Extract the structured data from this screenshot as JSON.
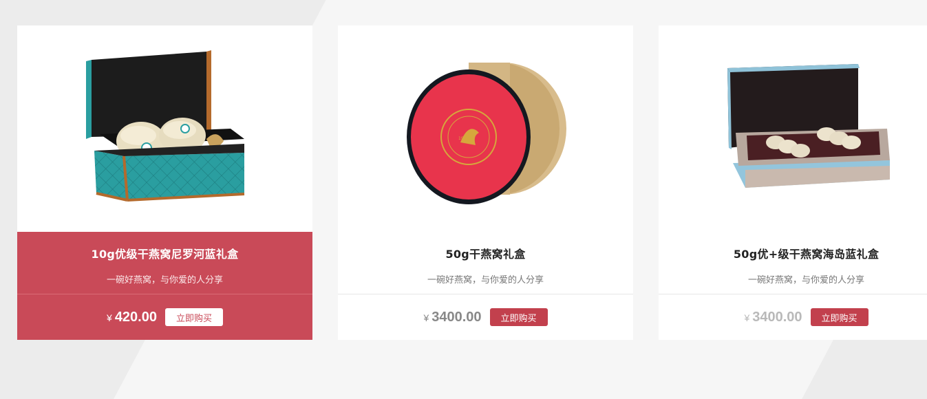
{
  "colors": {
    "accent": "#c94a58",
    "button": "#c2404d",
    "background": "#ececec"
  },
  "products": [
    {
      "name": "10g优级干燕窝尼罗河蓝礼盒",
      "slogan": "一碗好燕窝，与你爱的人分享",
      "currency": "¥",
      "price": "420.00",
      "buy_label": "立即购买",
      "image": "teal-quilted-gift-box-with-two-bird-nests"
    },
    {
      "name": "50g干燕窝礼盒",
      "slogan": "一碗好燕窝，与你爱的人分享",
      "currency": "¥",
      "price": "3400.00",
      "buy_label": "立即购买",
      "image": "round-red-and-gold-tin-box"
    },
    {
      "name": "50g优+级干燕窝海岛蓝礼盒",
      "slogan": "一碗好燕窝，与你爱的人分享",
      "currency": "¥",
      "price": "3400.00",
      "buy_label": "立即购买",
      "image": "light-blue-gift-box-with-bird-nests"
    }
  ]
}
